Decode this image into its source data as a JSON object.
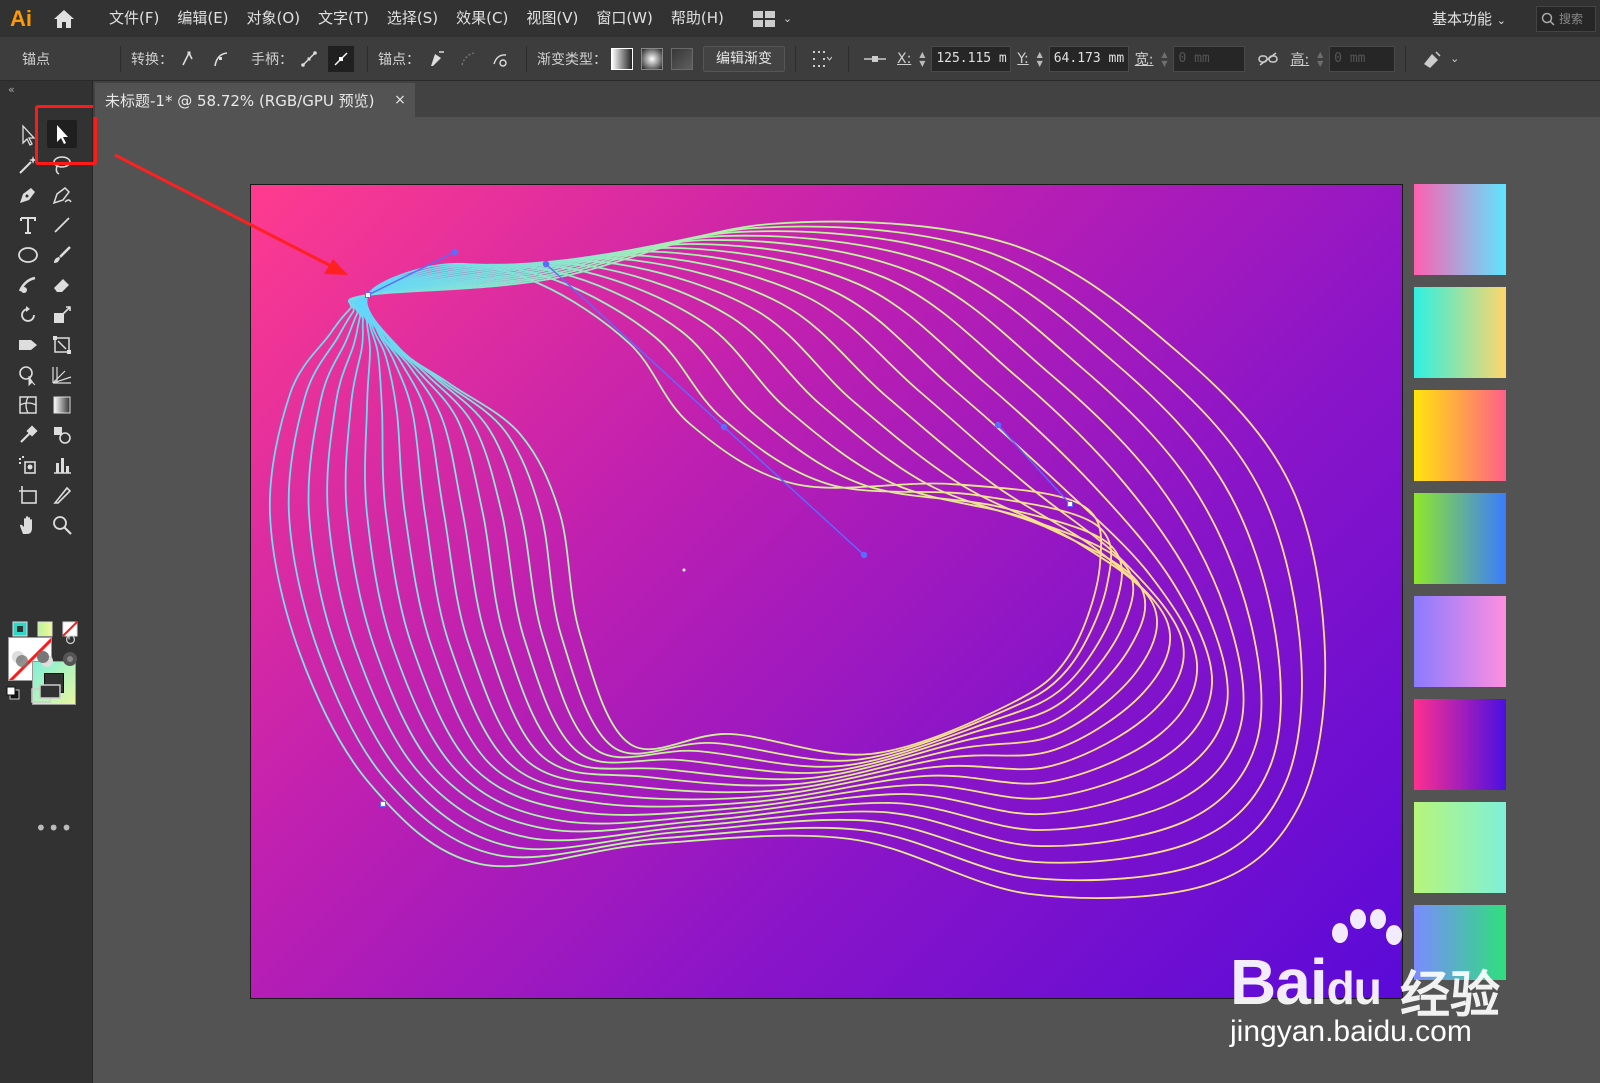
{
  "app": {
    "logo": "Ai"
  },
  "menu": [
    "文件(F)",
    "编辑(E)",
    "对象(O)",
    "文字(T)",
    "选择(S)",
    "效果(C)",
    "视图(V)",
    "窗口(W)",
    "帮助(H)"
  ],
  "workspace": {
    "label": "基本功能",
    "search_placeholder": "搜索"
  },
  "control": {
    "anchor_label": "锚点",
    "convert_label": "转换：",
    "handles_label": "手柄：",
    "anchors_label": "锚点：",
    "gradient_type_label": "渐变类型：",
    "edit_gradient": "编辑渐变",
    "x_label": "X:",
    "x_value": "125.115 m",
    "y_label": "Y:",
    "y_value": "64.173 mm",
    "w_label": "宽:",
    "w_value": "0 mm",
    "h_label": "高:",
    "h_value": "0 mm"
  },
  "document": {
    "tab_title": "未标题-1* @ 58.72% (RGB/GPU 预览)",
    "close": "×"
  },
  "toolbar": {
    "more": "•••"
  },
  "artwork": {
    "line_count": 16,
    "start_color": "#5fd4ff",
    "mid_color": "#b6f5a0",
    "end_color": "#ffe08a",
    "path_color": "#5a6cff"
  },
  "swatches": [
    {
      "from": "#ff5fb0",
      "to": "#5ee6ff"
    },
    {
      "from": "#2ef0e0",
      "to": "#ffd66b"
    },
    {
      "from": "#ffe60a",
      "to": "#ff5f8a"
    },
    {
      "from": "#8ee82a",
      "to": "#3a7bff"
    },
    {
      "from": "#8a7bff",
      "to": "#ff8fe0"
    },
    {
      "from": "#ff2f8e",
      "to": "#4a10e0"
    },
    {
      "from": "#b7f57a",
      "to": "#7ff0d8"
    },
    {
      "from": "#7a8bff",
      "to": "#2ee07a"
    }
  ],
  "watermark": {
    "brand": "Bai",
    "brand2": "du",
    "cn": "经验",
    "url": "jingyan.baidu.com"
  }
}
